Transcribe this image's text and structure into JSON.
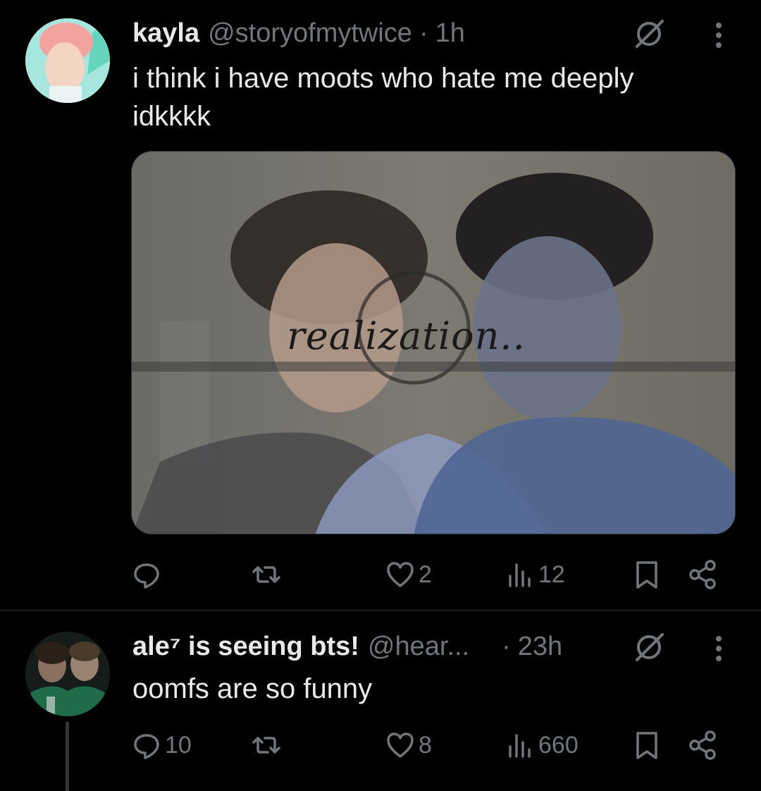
{
  "tweets": [
    {
      "name": "kayla",
      "handle": "@storyofmytwice",
      "separator": "·",
      "time": "1h",
      "text_line1": "i think i have moots who hate me deeply",
      "text_line2": "idkkkk",
      "media_text": "realization..",
      "actions": {
        "reply_count": "",
        "retweet_count": "",
        "like_count": "2",
        "views_count": "12"
      }
    },
    {
      "name": "ale⁷ is seeing bts!",
      "handle": "@hear...",
      "separator": "·",
      "time": "23h",
      "text_line1": "oomfs are so funny",
      "actions": {
        "reply_count": "10",
        "retweet_count": "",
        "like_count": "8",
        "views_count": "660"
      }
    }
  ],
  "colors": {
    "background": "#000000",
    "text_primary": "#e7e9ea",
    "text_secondary": "#71767b",
    "divider": "#2f3336"
  },
  "icons": [
    "reply-icon",
    "retweet-icon",
    "like-icon",
    "views-icon",
    "bookmark-icon",
    "share-icon",
    "grok-icon",
    "more-icon"
  ]
}
